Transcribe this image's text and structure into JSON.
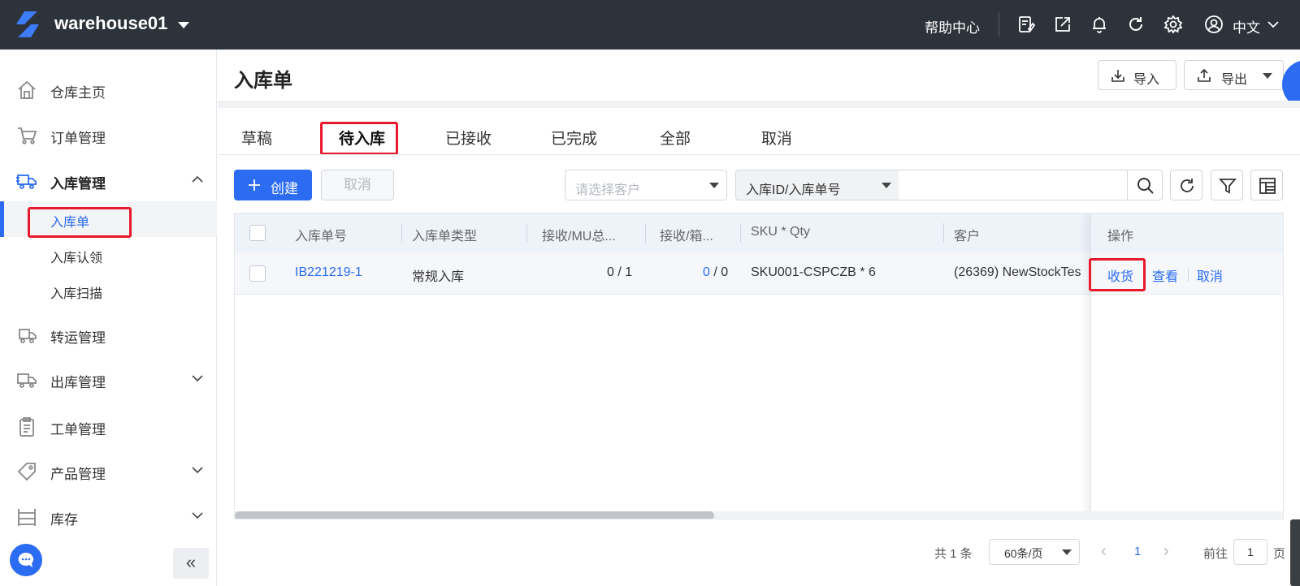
{
  "app": {
    "warehouse_name": "warehouse01",
    "help_center": "帮助中心",
    "language": "中文",
    "brand_color": "#2b6cf2",
    "header_icons": [
      "notes-icon",
      "share-icon",
      "bell-icon",
      "refresh-icon",
      "settings-icon",
      "user-icon"
    ]
  },
  "sidebar": {
    "items": [
      {
        "label": "仓库主页",
        "icon": "home-icon"
      },
      {
        "label": "订单管理",
        "icon": "cart-icon"
      },
      {
        "label": "入库管理",
        "icon": "inbound-truck-icon",
        "expanded": true
      },
      {
        "label": "转运管理",
        "icon": "transfer-truck-icon"
      },
      {
        "label": "出库管理",
        "icon": "outbound-truck-icon"
      },
      {
        "label": "工单管理",
        "icon": "clipboard-icon"
      },
      {
        "label": "产品管理",
        "icon": "tag-icon"
      },
      {
        "label": "库存",
        "icon": "shelf-icon"
      }
    ],
    "sub_items": [
      {
        "label": "入库单",
        "active": true
      },
      {
        "label": "入库认领"
      },
      {
        "label": "入库扫描"
      }
    ],
    "collapse_label": "«"
  },
  "page": {
    "title": "入库单",
    "import_label": "导入",
    "export_label": "导出"
  },
  "tabs": [
    {
      "label": "草稿"
    },
    {
      "label": "待入库",
      "active": true
    },
    {
      "label": "已接收"
    },
    {
      "label": "已完成"
    },
    {
      "label": "全部"
    },
    {
      "label": "取消"
    }
  ],
  "toolbar": {
    "create_label": "创建",
    "cancel_label": "取消",
    "customer_placeholder": "请选择客户",
    "search_type": "入库ID/入库单号",
    "search_value": ""
  },
  "table": {
    "columns": [
      "入库单号",
      "入库单类型",
      "接收/MU总...",
      "接收/箱...",
      "SKU * Qty",
      "客户",
      "操作"
    ],
    "rows": [
      {
        "id": "IB221219-1",
        "type": "常规入库",
        "mu": "0 / 1",
        "box_received": "0",
        "box_total": " / 0",
        "sku_qty": "SKU001-CSPCZB * 6",
        "customer": "(26369) NewStockTes",
        "actions": [
          "收货",
          "查看",
          "取消"
        ]
      }
    ]
  },
  "pagination": {
    "total": "共 1 条",
    "page_size": "60条/页",
    "current_page": "1",
    "goto_label": "前往",
    "goto_value": "1",
    "page_unit": "页"
  }
}
